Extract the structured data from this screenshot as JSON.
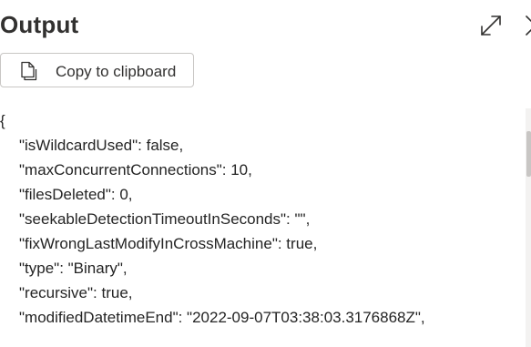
{
  "panel": {
    "title": "Output",
    "expand_icon": "expand-diagonal-arrows-icon",
    "close_icon": "close-icon"
  },
  "copy": {
    "label": "Copy to clipboard",
    "icon": "copy-icon"
  },
  "json_lines": [
    "{",
    "\"isWildcardUsed\": false,",
    "\"maxConcurrentConnections\": 10,",
    "\"filesDeleted\": 0,",
    "\"seekableDetectionTimeoutInSeconds\": \"\",",
    "\"fixWrongLastModifyInCrossMachine\": true,",
    "\"type\": \"Binary\",",
    "\"recursive\": true,",
    "\"modifiedDatetimeEnd\": \"2022-09-07T03:38:03.3176868Z\","
  ]
}
